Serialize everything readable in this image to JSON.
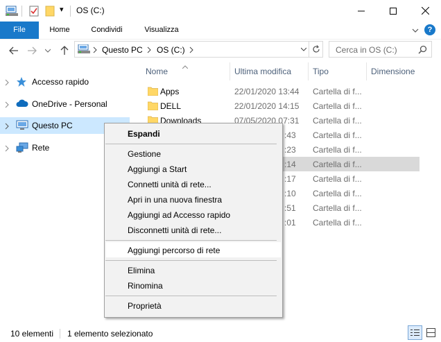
{
  "window": {
    "title": "OS (C:)",
    "quick_access_dropdown": "▾"
  },
  "ribbon": {
    "file_tab": "File",
    "tabs": [
      "Home",
      "Condividi",
      "Visualizza"
    ],
    "help": "?"
  },
  "address": {
    "crumbs": [
      "Questo PC",
      "OS (C:)"
    ]
  },
  "search": {
    "placeholder": "Cerca in OS (C:)"
  },
  "nav_pane": {
    "items": [
      {
        "label": "Accesso rapido",
        "icon": "star-icon"
      },
      {
        "label": "OneDrive - Personal",
        "icon": "cloud-icon"
      },
      {
        "label": "Questo PC",
        "icon": "computer-icon"
      },
      {
        "label": "Rete",
        "icon": "network-icon"
      }
    ]
  },
  "columns": {
    "name": "Nome",
    "date": "Ultima modifica",
    "type": "Tipo",
    "size": "Dimensione"
  },
  "files": [
    {
      "name": "Apps",
      "date": "22/01/2020 13:44",
      "type": "Cartella di f..."
    },
    {
      "name": "DELL",
      "date": "22/01/2020 14:15",
      "type": "Cartella di f..."
    },
    {
      "name": "Downloads",
      "date": "07/05/2020 07:31",
      "type": "Cartella di f..."
    },
    {
      "name": "",
      "date": ":43",
      "type": "Cartella di f..."
    },
    {
      "name": "",
      "date": ":23",
      "type": "Cartella di f..."
    },
    {
      "name": "",
      "date": ":14",
      "type": "Cartella di f..."
    },
    {
      "name": "",
      "date": ":17",
      "type": "Cartella di f..."
    },
    {
      "name": "",
      "date": ":10",
      "type": "Cartella di f..."
    },
    {
      "name": "",
      "date": ":51",
      "type": "Cartella di f..."
    },
    {
      "name": "",
      "date": ":01",
      "type": "Cartella di f..."
    }
  ],
  "context_menu": {
    "expand": "Espandi",
    "group1": [
      "Gestione",
      "Aggiungi a Start",
      "Connetti unità di rete...",
      "Apri in una nuova finestra",
      "Aggiungi ad Accesso rapido",
      "Disconnetti unità di rete..."
    ],
    "add_network_location": "Aggiungi percorso di rete",
    "group3": [
      "Elimina",
      "Rinomina"
    ],
    "properties": "Proprietà"
  },
  "status": {
    "count": "10 elementi",
    "selected": "1 elemento selezionato"
  },
  "colors": {
    "accent": "#1979ca",
    "selection": "#cce8ff",
    "folder": "#ffd766"
  }
}
